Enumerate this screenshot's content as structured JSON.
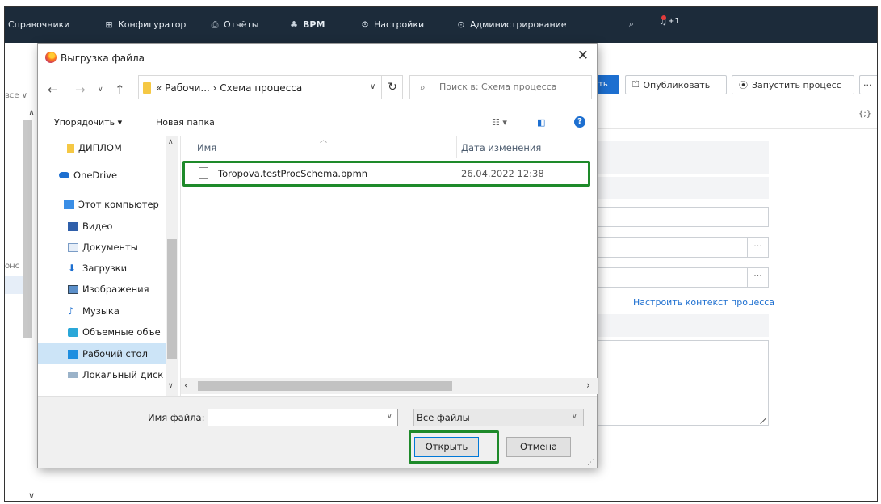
{
  "topbar": {
    "items": [
      {
        "label": "Справочники",
        "icon": ""
      },
      {
        "label": "Конфигуратор",
        "icon": "grid-icon"
      },
      {
        "label": "Отчёты",
        "icon": "printer-icon"
      },
      {
        "label": "BPM",
        "icon": "hierarchy-icon"
      },
      {
        "label": "Настройки",
        "icon": "gear-icon"
      },
      {
        "label": "Администрирование",
        "icon": "shield-icon"
      }
    ],
    "notif_count": "+1"
  },
  "app": {
    "blue_btn_fragment": "ть",
    "publish_label": "Опубликовать",
    "run_label": "Запустить процесс",
    "more_label": "···",
    "left_fragment_top": "все ∨",
    "left_fragment_mid": "онс",
    "field_dots": "···",
    "configure_link": "Настроить контекст процесса",
    "braces": "{;}"
  },
  "dialog": {
    "title": "Выгрузка файла",
    "address": {
      "path": "« Рабочи... › Схема процесса"
    },
    "search": {
      "placeholder": "Поиск в: Схема процесса"
    },
    "commands": {
      "organize": "Упорядочить ▾",
      "new_folder": "Новая папка",
      "help": "?"
    },
    "nav_items": [
      {
        "label": "ДИПЛОМ",
        "icon": "folder-icon",
        "selected": false
      },
      {
        "label": "OneDrive",
        "icon": "cloud-icon",
        "selected": false
      },
      {
        "label": "Этот компьютер",
        "icon": "computer-icon",
        "selected": false
      },
      {
        "label": "Видео",
        "icon": "video-icon",
        "selected": false
      },
      {
        "label": "Документы",
        "icon": "documents-icon",
        "selected": false
      },
      {
        "label": "Загрузки",
        "icon": "download-icon",
        "selected": false
      },
      {
        "label": "Изображения",
        "icon": "images-icon",
        "selected": false
      },
      {
        "label": "Музыка",
        "icon": "music-icon",
        "selected": false
      },
      {
        "label": "Объемные объе",
        "icon": "3d-objects-icon",
        "selected": false
      },
      {
        "label": "Рабочий стол",
        "icon": "desktop-icon",
        "selected": true
      },
      {
        "label": "Локальный диск",
        "icon": "drive-icon",
        "selected": false
      }
    ],
    "columns": {
      "name": "Имя",
      "date": "Дата изменения"
    },
    "files": [
      {
        "name": "Toropova.testProcSchema.bpmn",
        "date": "26.04.2022 12:38"
      }
    ],
    "file_name_label": "Имя файла:",
    "file_name_value": "",
    "file_type": "Все файлы",
    "open_label": "Открыть",
    "cancel_label": "Отмена"
  },
  "colors": {
    "topbar_bg": "#1c2b3a",
    "accent": "#1d6fd0",
    "highlight_green": "#1e8a2a",
    "selection": "#cce4f7"
  }
}
